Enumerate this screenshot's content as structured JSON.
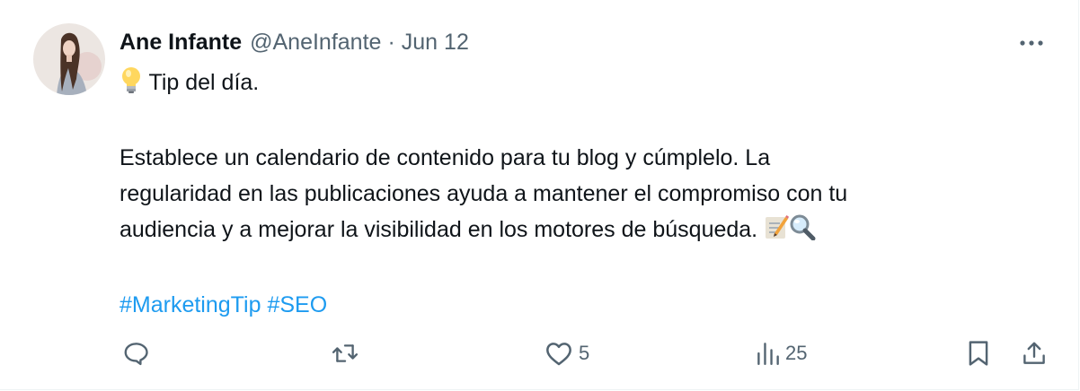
{
  "tweet": {
    "author_name": "Ane Infante",
    "author_handle": "@AneInfante",
    "separator": "·",
    "date": "Jun 12",
    "lines": {
      "tip": "Tip del día.",
      "p1": "Establece un calendario de contenido para tu blog y cúmplelo. La",
      "p2": "regularidad en las publicaciones ayuda a mantener el compromiso con tu",
      "p3": "audiencia y a mejorar la visibilidad en los motores de búsqueda."
    },
    "emojis": [
      "light-bulb",
      "memo",
      "magnifying-glass"
    ],
    "hashtags": [
      "#MarketingTip",
      "#SEO"
    ]
  },
  "actions": {
    "replies": "",
    "reposts": "",
    "likes": "5",
    "views": "25"
  },
  "icons": [
    "more-icon",
    "reply-icon",
    "repost-icon",
    "like-icon",
    "views-icon",
    "bookmark-icon",
    "share-icon"
  ],
  "colors": {
    "text": "#0f1419",
    "secondary": "#536471",
    "link": "#1d9bf0"
  }
}
